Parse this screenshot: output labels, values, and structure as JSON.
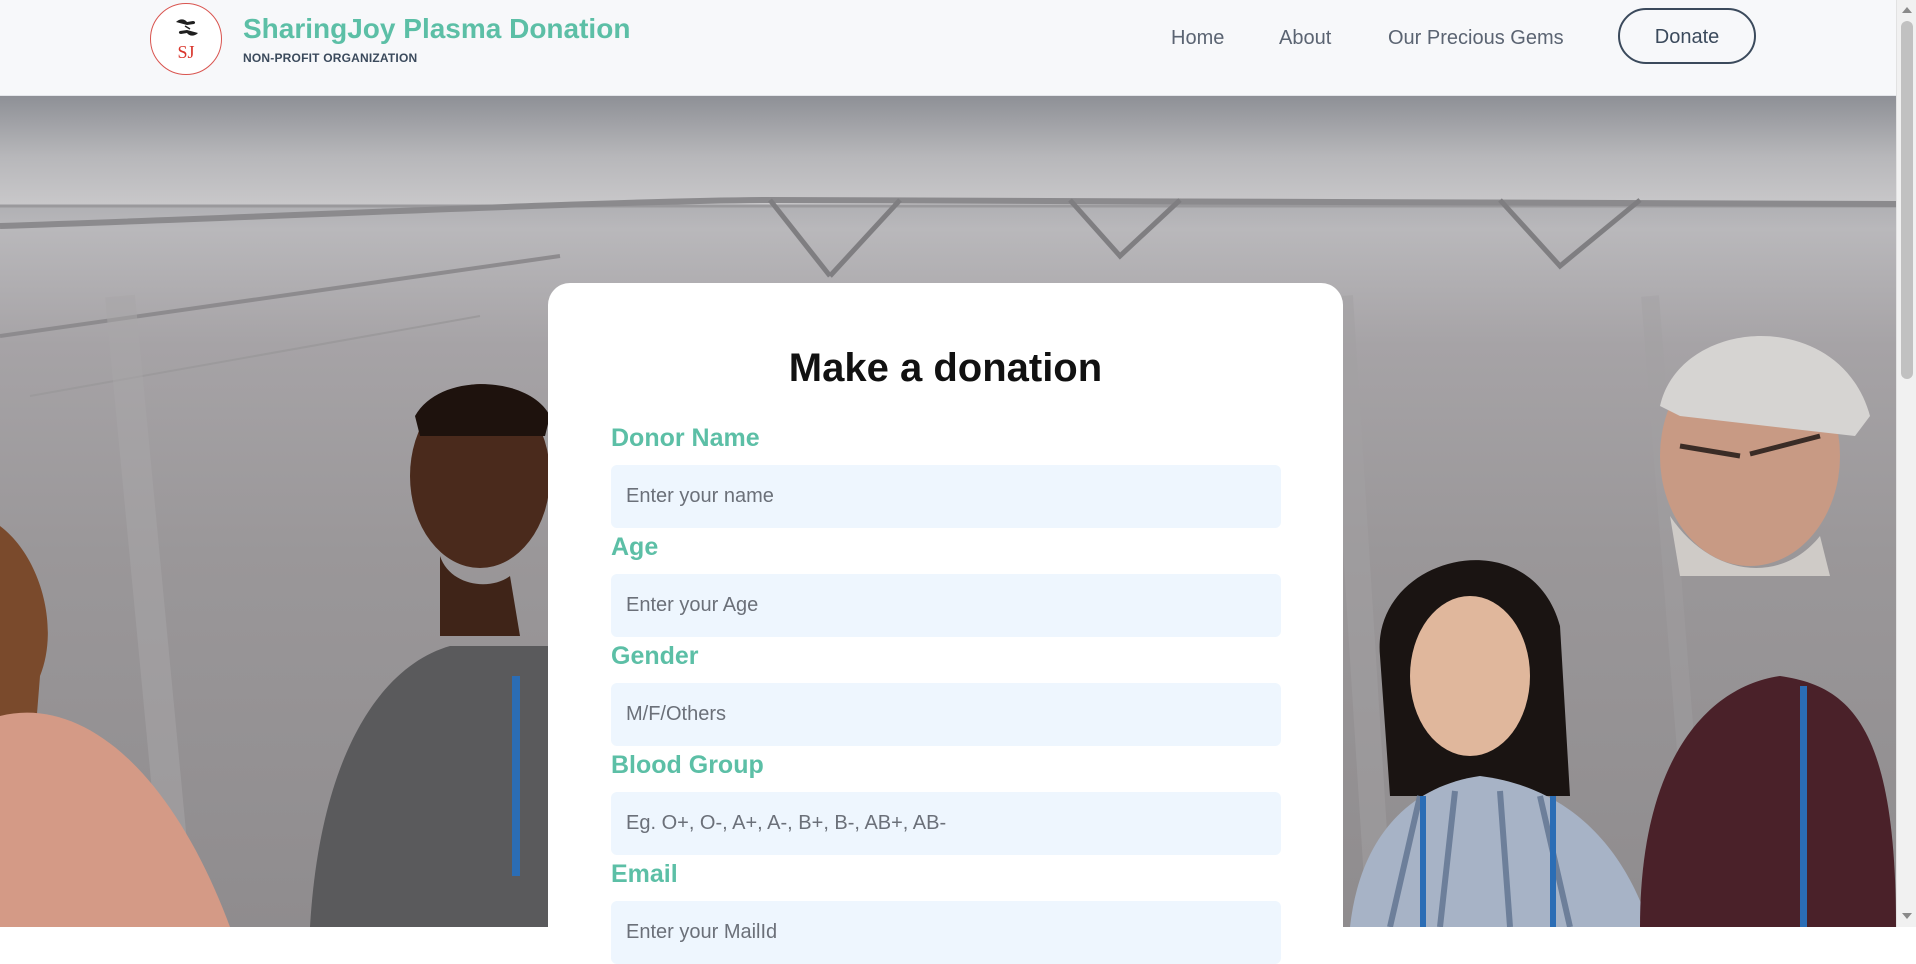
{
  "brand": {
    "logo_initials": "SJ",
    "name": "SharingJoy Plasma Donation",
    "subtitle": "NON-PROFIT ORGANIZATION"
  },
  "nav": {
    "home": "Home",
    "about": "About",
    "gems": "Our Precious Gems",
    "donate": "Donate"
  },
  "form": {
    "title": "Make a donation",
    "fields": [
      {
        "label": "Donor Name",
        "placeholder": "Enter your name"
      },
      {
        "label": "Age",
        "placeholder": "Enter your Age"
      },
      {
        "label": "Gender",
        "placeholder": "M/F/Others"
      },
      {
        "label": "Blood Group",
        "placeholder": "Eg. O+, O-, A+, A-, B+, B-, AB+, AB-"
      },
      {
        "label": "Email",
        "placeholder": "Enter your MailId"
      }
    ]
  },
  "colors": {
    "accent": "#5cbfa6",
    "navy": "#3b4a5c",
    "input_bg": "#eef6fe",
    "logo_red": "#d9342b"
  },
  "icons": {
    "logo": "hands-giving-icon"
  }
}
